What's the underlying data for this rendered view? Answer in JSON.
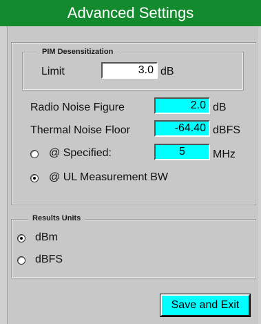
{
  "window": {
    "title": "Advanced Settings"
  },
  "pim_group": {
    "legend": "PIM Desensitization",
    "limit_label": "Limit",
    "limit_value": "3.0",
    "limit_unit": "dB"
  },
  "noise": {
    "radio_nf_label": "Radio Noise Figure",
    "radio_nf_value": "2.0",
    "radio_nf_unit": "dB",
    "thermal_label": "Thermal Noise Floor",
    "thermal_value": "-64.40",
    "thermal_unit": "dBFS",
    "specified_label": "@ Specified:",
    "specified_value": "5",
    "specified_unit": "MHz",
    "specified_selected": false,
    "ul_bw_label": "@ UL Measurement BW",
    "ul_bw_selected": true
  },
  "results_units": {
    "legend": "Results Units",
    "options": [
      {
        "label": "dBm",
        "selected": true
      },
      {
        "label": "dBFS",
        "selected": false
      }
    ]
  },
  "actions": {
    "save_exit_label": "Save and Exit"
  },
  "colors": {
    "title_bg": "#148a2e",
    "field_accent": "#00ffff",
    "panel_bg": "#c8c8c8"
  }
}
